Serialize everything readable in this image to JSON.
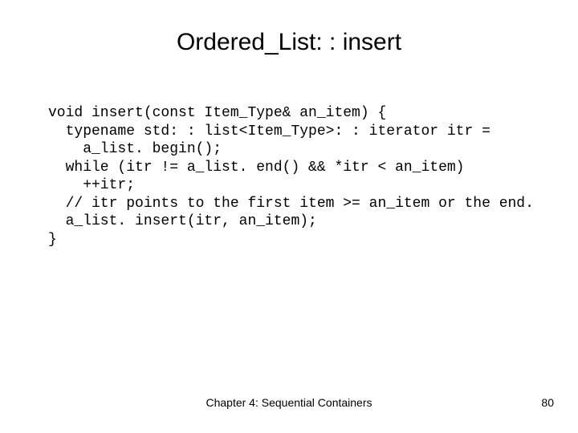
{
  "title": "Ordered_List: : insert",
  "code": {
    "l1": "void insert(const Item_Type& an_item) {",
    "l2": "  typename std: : list<Item_Type>: : iterator itr =",
    "l3": "    a_list. begin();",
    "l4": "  while (itr != a_list. end() && *itr < an_item)",
    "l5": "    ++itr;",
    "l6": "  // itr points to the first item >= an_item or the end.",
    "l7": "  a_list. insert(itr, an_item);",
    "l8": "}"
  },
  "footer": {
    "chapter": "Chapter 4: Sequential Containers",
    "page": "80"
  }
}
